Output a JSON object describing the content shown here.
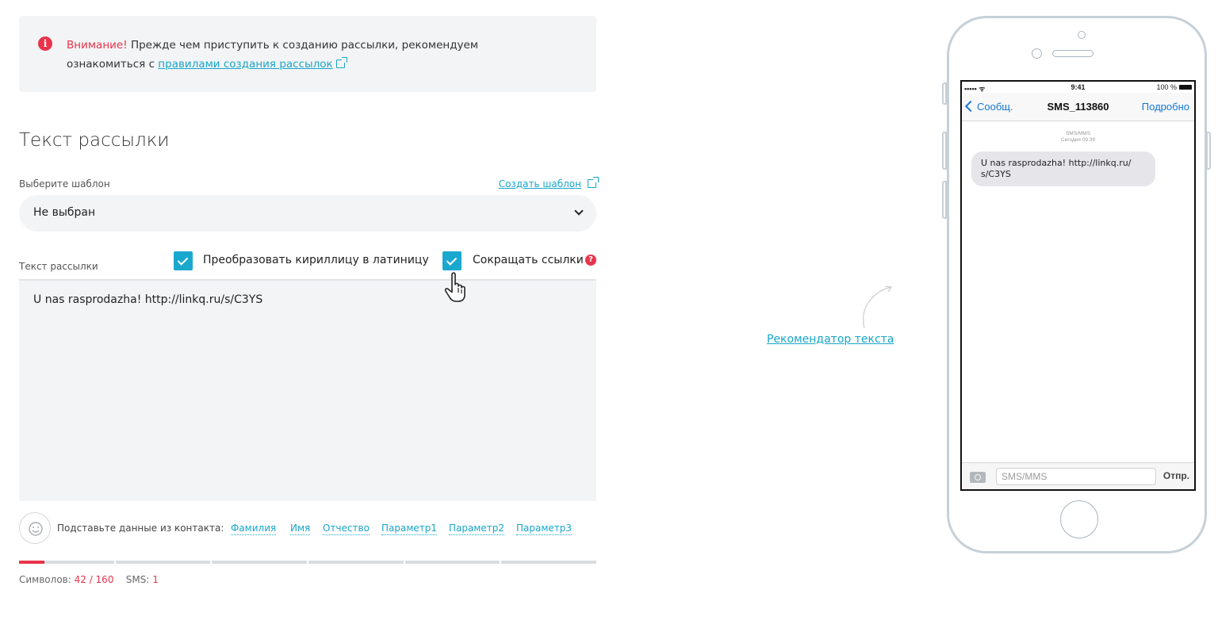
{
  "notice": {
    "title": "Внимание!",
    "text_before": "Прежде чем приступить к созданию рассылки, рекомендуем ознакомиться с",
    "link_label": "правилами создания рассылок"
  },
  "section_title": "Текст рассылки",
  "template": {
    "label": "Выберите шаблон",
    "create_link": "Создать шаблон",
    "selected": "Не выбран"
  },
  "message": {
    "label": "Текст рассылки",
    "transliterate_label": "Преобразовать кириллицу в латиницу",
    "transliterate_checked": true,
    "shorten_label": "Сокращать ссылки",
    "shorten_checked": true,
    "text": "U nas rasprodazha! http://linkq.ru/s/C3YS"
  },
  "contact_fields": {
    "label": "Подставьте данные из контакта:",
    "items": [
      "Фамилия",
      "Имя",
      "Отчество",
      "Параметр1",
      "Параметр2",
      "Параметр3"
    ]
  },
  "counter": {
    "symbols_label": "Символов:",
    "symbols_value": "42 / 160",
    "symbols_used": 42,
    "symbols_max": 160,
    "sms_label": "SMS:",
    "sms_value": "1"
  },
  "recommender_link": "Рекомендатор текста",
  "phone": {
    "status_signal": "••••• ᯤ",
    "status_time": "9:41",
    "status_battery": "100 %",
    "back_label": "Сообщ.",
    "title": "SMS_113860",
    "more_label": "Подробно",
    "meta_type": "SMS/MMS",
    "meta_time": "Сегодня 09:39",
    "bubble_text": "U nas rasprodazha! http://linkq.ru/ s/C3YS",
    "input_placeholder": "SMS/MMS",
    "send_label": "Отпр."
  },
  "colors": {
    "accent": "#1ba8cf",
    "link": "#18a6c9",
    "warning": "#e8344b",
    "panel": "#f3f4f6",
    "phone_frame": "#c6d0d8"
  }
}
